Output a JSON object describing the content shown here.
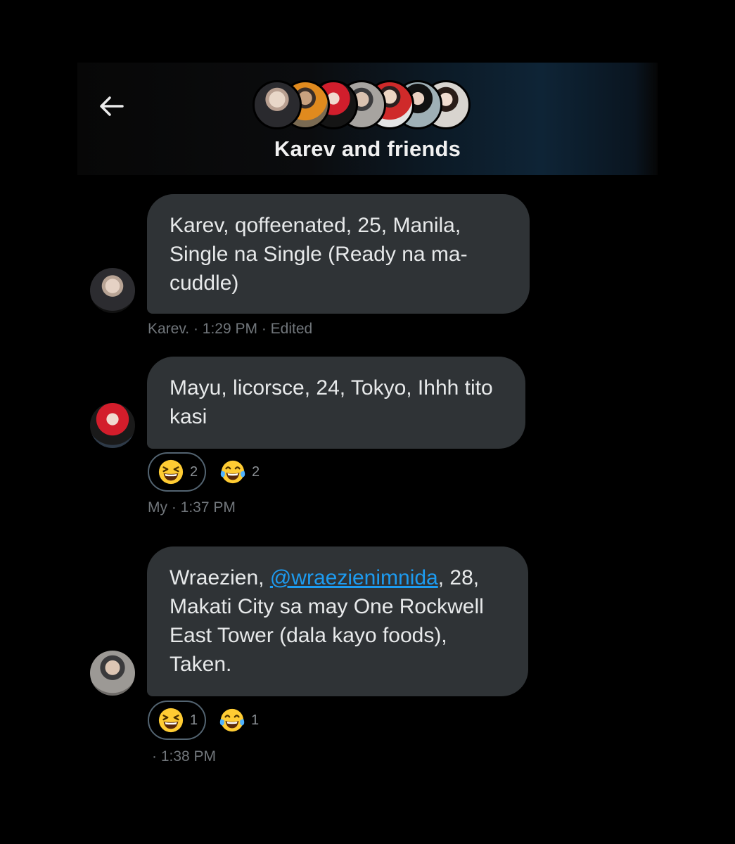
{
  "header": {
    "title": "Karev and friends",
    "back_icon": "back-arrow-icon"
  },
  "messages": [
    {
      "text": "Karev, qoffeenated, 25, Manila, Single na Single (Ready na ma-cuddle)",
      "meta": "Karev. · 1:29 PM · Edited"
    },
    {
      "text": "Mayu, licorsce, 24, Tokyo, Ihhh tito kasi",
      "reactions": [
        {
          "emoji": "grinning-squinting-face",
          "count": "2"
        },
        {
          "emoji": "face-with-tears-of-joy",
          "count": "2"
        }
      ],
      "meta": "My · 1:37 PM"
    },
    {
      "text_before": "Wraezien, ",
      "mention": "@wraezienimnida",
      "text_after": ", 28, Makati City sa may One Rockwell East Tower (dala kayo foods), Taken.",
      "reactions": [
        {
          "emoji": "grinning-squinting-face",
          "count": "1"
        },
        {
          "emoji": "face-with-tears-of-joy",
          "count": "1"
        }
      ],
      "meta": "· 1:38 PM"
    }
  ],
  "colors": {
    "background": "#000000",
    "bubble": "#2f3336",
    "meta_text": "#71767b",
    "mention": "#1d9bf0"
  }
}
